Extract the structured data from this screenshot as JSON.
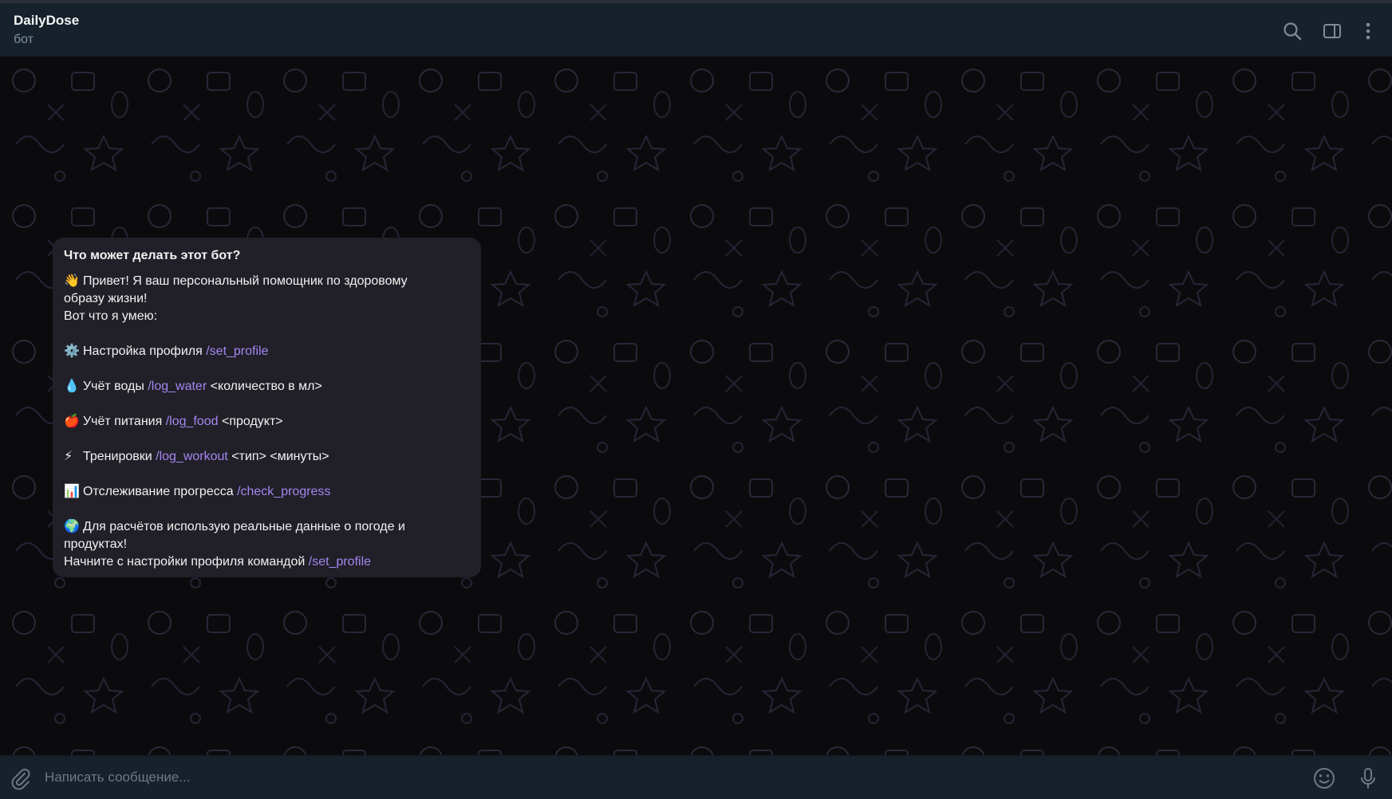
{
  "header": {
    "title": "DailyDose",
    "subtitle": "бот",
    "icons": [
      "search-icon",
      "sidebar-toggle-icon",
      "more-vertical-icon"
    ]
  },
  "message": {
    "title": "Что может делать этот бот?",
    "lines": [
      {
        "emoji": "👋",
        "text": "Привет! Я ваш персональный помощник по здоровому",
        "cmd": "",
        "after": ""
      },
      {
        "emoji": "",
        "text": "образу жизни!",
        "cmd": "",
        "after": ""
      },
      {
        "emoji": "",
        "text": "Вот что я умею:",
        "cmd": "",
        "after": ""
      },
      {
        "emoji": "⚙️",
        "text": "Настройка профиля ",
        "cmd": "/set_profile",
        "after": ""
      },
      {
        "emoji": "💧",
        "text": "Учёт воды ",
        "cmd": "/log_water",
        "after": " <количество в мл>"
      },
      {
        "emoji": "🍎",
        "text": "Учёт питания ",
        "cmd": "/log_food",
        "after": " <продукт>"
      },
      {
        "emoji": "⚡",
        "text": "Тренировки ",
        "cmd": "/log_workout",
        "after": " <тип> <минуты>"
      },
      {
        "emoji": "📊",
        "text": "Отслеживание прогресса ",
        "cmd": "/check_progress",
        "after": ""
      },
      {
        "emoji": "🌍",
        "text": "Для расчётов использую реальные данные о погоде и",
        "cmd": "",
        "after": ""
      },
      {
        "emoji": "",
        "text": "продуктах!",
        "cmd": "",
        "after": ""
      },
      {
        "emoji": "",
        "text": "Начните с настройки профиля командой ",
        "cmd": "/set_profile",
        "after": ""
      }
    ]
  },
  "composer": {
    "placeholder": "Написать сообщение...",
    "icons": [
      "paperclip-icon",
      "emoji-icon",
      "microphone-icon"
    ]
  },
  "colors": {
    "header_bg": "#17212b",
    "chat_bg": "#0b0b0e",
    "bubble_bg": "#212028",
    "command": "#a486f0"
  }
}
